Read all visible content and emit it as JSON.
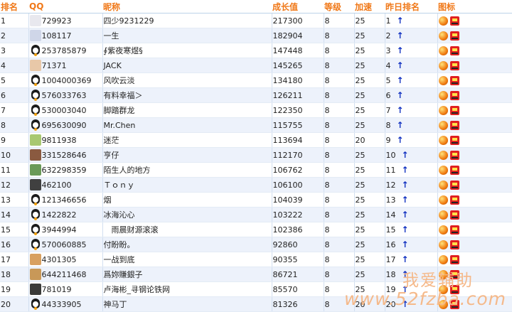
{
  "headers": {
    "rank": "排名",
    "qq": "QQ",
    "nickname": "昵称",
    "growth": "成长值",
    "level": "等级",
    "speed": "加速",
    "yesterday_rank": "昨日排名",
    "icons": "图标"
  },
  "rows": [
    {
      "rank": "1",
      "qq": "729923",
      "nickname": "四少9231229",
      "growth": "217300",
      "level": "8",
      "speed": "25",
      "yesterday": "1",
      "avatar": "cat-avatar",
      "avatar_color": "#e8e8ee"
    },
    {
      "rank": "2",
      "qq": "108117",
      "nickname": "一生",
      "growth": "182904",
      "level": "8",
      "speed": "25",
      "yesterday": "2",
      "avatar": "rabbit-avatar",
      "avatar_color": "#cfd6e8"
    },
    {
      "rank": "3",
      "qq": "253785879",
      "nickname": "∮紫夜寒煜§",
      "growth": "147448",
      "level": "8",
      "speed": "25",
      "yesterday": "3",
      "avatar": "penguin-avatar",
      "avatar_color": ""
    },
    {
      "rank": "4",
      "qq": "71371",
      "nickname": "JACK",
      "growth": "145265",
      "level": "8",
      "speed": "25",
      "yesterday": "4",
      "avatar": "baby-avatar",
      "avatar_color": "#e8c8a8"
    },
    {
      "rank": "5",
      "qq": "1004000369",
      "nickname": "风吹云淡",
      "growth": "134180",
      "level": "8",
      "speed": "25",
      "yesterday": "5",
      "avatar": "penguin-avatar",
      "avatar_color": ""
    },
    {
      "rank": "6",
      "qq": "576033763",
      "nickname": "有料幸福＞",
      "growth": "126211",
      "level": "8",
      "speed": "25",
      "yesterday": "6",
      "avatar": "penguin-avatar",
      "avatar_color": ""
    },
    {
      "rank": "7",
      "qq": "530003040",
      "nickname": "脚踏群龙",
      "growth": "122350",
      "level": "8",
      "speed": "25",
      "yesterday": "7",
      "avatar": "penguin-avatar",
      "avatar_color": ""
    },
    {
      "rank": "8",
      "qq": "695630090",
      "nickname": "Mr.Chen",
      "growth": "115755",
      "level": "8",
      "speed": "25",
      "yesterday": "8",
      "avatar": "penguin-avatar",
      "avatar_color": ""
    },
    {
      "rank": "9",
      "qq": "9811938",
      "nickname": "迷茫",
      "growth": "113694",
      "level": "8",
      "speed": "20",
      "yesterday": "9",
      "avatar": "cartoon-avatar",
      "avatar_color": "#a8c870"
    },
    {
      "rank": "10",
      "qq": "331528646",
      "nickname": "亨仔",
      "growth": "112170",
      "level": "8",
      "speed": "25",
      "yesterday": "10",
      "avatar": "photo-avatar",
      "avatar_color": "#8a5a40"
    },
    {
      "rank": "11",
      "qq": "632298359",
      "nickname": "陌生人的地方",
      "growth": "106762",
      "level": "8",
      "speed": "25",
      "yesterday": "11",
      "avatar": "landscape-avatar",
      "avatar_color": "#6a9a58"
    },
    {
      "rank": "12",
      "qq": "462100",
      "nickname": "Ｔｏｎｙ",
      "growth": "106100",
      "level": "8",
      "speed": "25",
      "yesterday": "12",
      "avatar": "panda-avatar",
      "avatar_color": "#404040"
    },
    {
      "rank": "13",
      "qq": "121346656",
      "nickname": "烟",
      "growth": "104039",
      "level": "8",
      "speed": "25",
      "yesterday": "13",
      "avatar": "penguin-avatar",
      "avatar_color": ""
    },
    {
      "rank": "14",
      "qq": "1422822",
      "nickname": "冰海沁心",
      "growth": "103222",
      "level": "8",
      "speed": "25",
      "yesterday": "14",
      "avatar": "penguin-avatar",
      "avatar_color": ""
    },
    {
      "rank": "15",
      "qq": "3944994",
      "nickname": "　雨晨财源滚滚",
      "growth": "102386",
      "level": "8",
      "speed": "25",
      "yesterday": "15",
      "avatar": "penguin-avatar",
      "avatar_color": ""
    },
    {
      "rank": "16",
      "qq": "570060885",
      "nickname": "付盼盼。",
      "growth": "92860",
      "level": "8",
      "speed": "25",
      "yesterday": "16",
      "avatar": "penguin-avatar",
      "avatar_color": ""
    },
    {
      "rank": "17",
      "qq": "4301305",
      "nickname": "一战到底",
      "growth": "90355",
      "level": "8",
      "speed": "25",
      "yesterday": "17",
      "avatar": "anime-avatar",
      "avatar_color": "#d8a060"
    },
    {
      "rank": "18",
      "qq": "644211468",
      "nickname": "爲妳賺銀子",
      "growth": "86721",
      "level": "8",
      "speed": "25",
      "yesterday": "18",
      "avatar": "anime-avatar",
      "avatar_color": "#c89858"
    },
    {
      "rank": "19",
      "qq": "781019",
      "nickname": "卢海彬_寻钢论铁网",
      "growth": "85570",
      "level": "8",
      "speed": "25",
      "yesterday": "19",
      "avatar": "photo-avatar",
      "avatar_color": "#3a3a38"
    },
    {
      "rank": "20",
      "qq": "44333905",
      "nickname": "神马丁",
      "growth": "81326",
      "level": "8",
      "speed": "20",
      "yesterday": "20",
      "avatar": "penguin-avatar",
      "avatar_color": ""
    }
  ],
  "arrow_symbol": "↑",
  "row_icons": [
    "fire-ball-icon",
    "robot-icon"
  ],
  "watermark": {
    "top": "我爱辅助",
    "url": "www.52fzba.com"
  }
}
